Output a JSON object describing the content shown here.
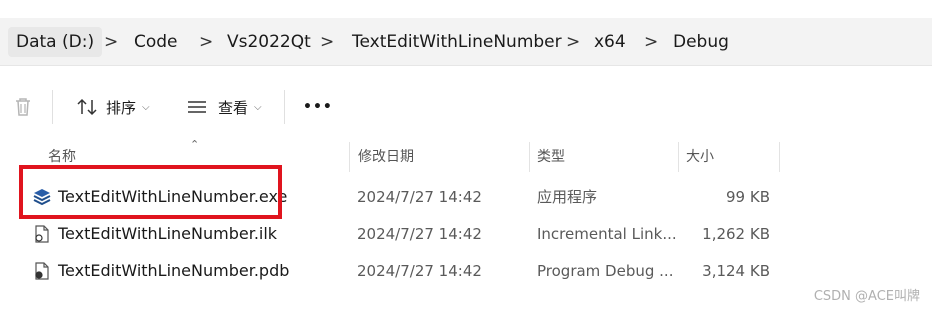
{
  "breadcrumb": {
    "root": "Data (D:)",
    "items": [
      "Code",
      "Vs2022Qt",
      "TextEditWithLineNumber",
      "x64",
      "Debug"
    ],
    "separator": ">"
  },
  "toolbar": {
    "sort_label": "排序",
    "view_label": "查看",
    "more_label": "•••"
  },
  "columns": {
    "name": "名称",
    "date": "修改日期",
    "type": "类型",
    "size": "大小"
  },
  "files": [
    {
      "name": "TextEditWithLineNumber.exe",
      "date": "2024/7/27 14:42",
      "type": "应用程序",
      "size": "99 KB",
      "icon": "exe-icon"
    },
    {
      "name": "TextEditWithLineNumber.ilk",
      "date": "2024/7/27 14:42",
      "type": "Incremental Link...",
      "size": "1,262 KB",
      "icon": "file-icon"
    },
    {
      "name": "TextEditWithLineNumber.pdb",
      "date": "2024/7/27 14:42",
      "type": "Program Debug ...",
      "size": "3,124 KB",
      "icon": "file-icon"
    }
  ],
  "watermark": "CSDN @ACE叫牌",
  "colors": {
    "highlight": "#e0141e",
    "exe_icon": "#1f4e8c"
  }
}
